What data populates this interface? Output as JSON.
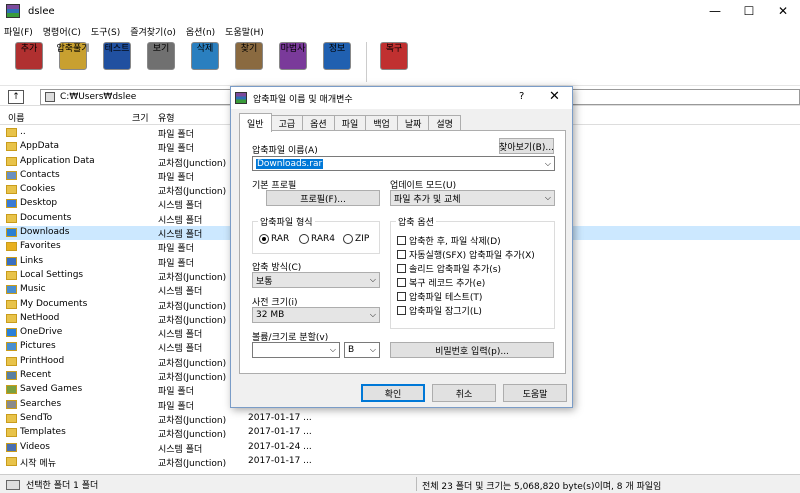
{
  "window": {
    "title": "dslee",
    "controls": [
      "—",
      "☐",
      "✕"
    ]
  },
  "menu": [
    "파일(F)",
    "명령어(C)",
    "도구(S)",
    "즐겨찾기(o)",
    "옵션(n)",
    "도움말(H)"
  ],
  "toolbar": {
    "group1": [
      {
        "label": "추가",
        "icon": "add-icon",
        "color": "#b03030"
      },
      {
        "label": "압축풀기",
        "icon": "extract-icon",
        "color": "#c8a030"
      },
      {
        "label": "테스트",
        "icon": "test-icon",
        "color": "#2050a0"
      },
      {
        "label": "보기",
        "icon": "view-icon",
        "color": "#707070"
      },
      {
        "label": "삭제",
        "icon": "delete-icon",
        "color": "#2a7fbf"
      },
      {
        "label": "찾기",
        "icon": "find-icon",
        "color": "#8a6a40"
      },
      {
        "label": "마법사",
        "icon": "wizard-icon",
        "color": "#7a3a9a"
      },
      {
        "label": "정보",
        "icon": "info-icon",
        "color": "#2060b0"
      }
    ],
    "group2": [
      {
        "label": "복구",
        "icon": "repair-icon",
        "color": "#c03030"
      }
    ]
  },
  "address": {
    "up_icon": "↑",
    "path": "C:₩Users₩dslee"
  },
  "columns": {
    "name": "이름",
    "size": "크기",
    "type": "유형"
  },
  "files": [
    {
      "name": "..",
      "type": "파일 폴더",
      "date": "",
      "icon": "folder"
    },
    {
      "name": "AppData",
      "type": "파일 폴더",
      "date": "",
      "icon": "folder"
    },
    {
      "name": "Application Data",
      "type": "교차점(Junction)",
      "date": "",
      "icon": "folder"
    },
    {
      "name": "Contacts",
      "type": "파일 폴더",
      "date": "",
      "icon": "contacts"
    },
    {
      "name": "Cookies",
      "type": "교차점(Junction)",
      "date": "",
      "icon": "folder"
    },
    {
      "name": "Desktop",
      "type": "시스템 폴더",
      "date": "",
      "icon": "desktop"
    },
    {
      "name": "Documents",
      "type": "시스템 폴더",
      "date": "",
      "icon": "documents"
    },
    {
      "name": "Downloads",
      "type": "시스템 폴더",
      "date": "",
      "icon": "downloads",
      "selected": true
    },
    {
      "name": "Favorites",
      "type": "파일 폴더",
      "date": "",
      "icon": "favorites"
    },
    {
      "name": "Links",
      "type": "파일 폴더",
      "date": "",
      "icon": "links"
    },
    {
      "name": "Local Settings",
      "type": "교차점(Junction)",
      "date": "",
      "icon": "folder"
    },
    {
      "name": "Music",
      "type": "시스템 폴더",
      "date": "",
      "icon": "music"
    },
    {
      "name": "My Documents",
      "type": "교차점(Junction)",
      "date": "",
      "icon": "folder"
    },
    {
      "name": "NetHood",
      "type": "교차점(Junction)",
      "date": "",
      "icon": "folder"
    },
    {
      "name": "OneDrive",
      "type": "시스템 폴더",
      "date": "",
      "icon": "onedrive"
    },
    {
      "name": "Pictures",
      "type": "시스템 폴더",
      "date": "",
      "icon": "pictures"
    },
    {
      "name": "PrintHood",
      "type": "교차점(Junction)",
      "date": "",
      "icon": "folder"
    },
    {
      "name": "Recent",
      "type": "교차점(Junction)",
      "date": "",
      "icon": "recent"
    },
    {
      "name": "Saved Games",
      "type": "파일 폴더",
      "date": "",
      "icon": "games"
    },
    {
      "name": "Searches",
      "type": "파일 폴더",
      "date": "",
      "icon": "searches"
    },
    {
      "name": "SendTo",
      "type": "교차점(Junction)",
      "date": "2017-01-17 ...",
      "icon": "folder"
    },
    {
      "name": "Templates",
      "type": "교차점(Junction)",
      "date": "2017-01-17 ...",
      "icon": "folder"
    },
    {
      "name": "Videos",
      "type": "시스템 폴더",
      "date": "2017-01-24 ...",
      "icon": "videos"
    },
    {
      "name": "시작 메뉴",
      "type": "교차점(Junction)",
      "date": "2017-01-17 ...",
      "icon": "folder"
    }
  ],
  "status": {
    "left": "선택한 폴더 1 폴더",
    "right": "전체 23 폴더 및 크기는 5,068,820 byte(s)이며, 8 개 파일임"
  },
  "dialog": {
    "title": "압축파일 이름 및 매개변수",
    "help": "?",
    "close": "✕",
    "tabs": [
      "일반",
      "고급",
      "옵션",
      "파일",
      "백업",
      "날짜",
      "설명"
    ],
    "archive_name_label": "압축파일 이름(A)",
    "browse_button": "찾아보기(B)...",
    "archive_name_value": "Downloads.rar",
    "profile_label": "기본 프로필",
    "profile_button": "프로필(F)...",
    "update_mode_label": "업데이트 모드(U)",
    "update_mode_value": "파일 추가 및 교체",
    "format_group": "압축파일 형식",
    "formats": [
      {
        "label": "RAR",
        "checked": true
      },
      {
        "label": "RAR4",
        "checked": false
      },
      {
        "label": "ZIP",
        "checked": false
      }
    ],
    "options_group": "압축 옵션",
    "options": [
      "압축한 후, 파일 삭제(D)",
      "자동실행(SFX) 압축파일 추가(X)",
      "솔리드 압축파일 추가(s)",
      "복구 레코드 추가(e)",
      "압축파일 테스트(T)",
      "압축파일 잠그기(L)"
    ],
    "method_label": "압축 방식(C)",
    "method_value": "보통",
    "dict_label": "사전 크기(i)",
    "dict_value": "32 MB",
    "split_label": "볼륨/크기로 분할(v)",
    "split_value": "",
    "split_unit": "B",
    "password_button": "비밀번호 입력(p)...",
    "ok": "확인",
    "cancel": "취소",
    "help_button": "도움말"
  }
}
